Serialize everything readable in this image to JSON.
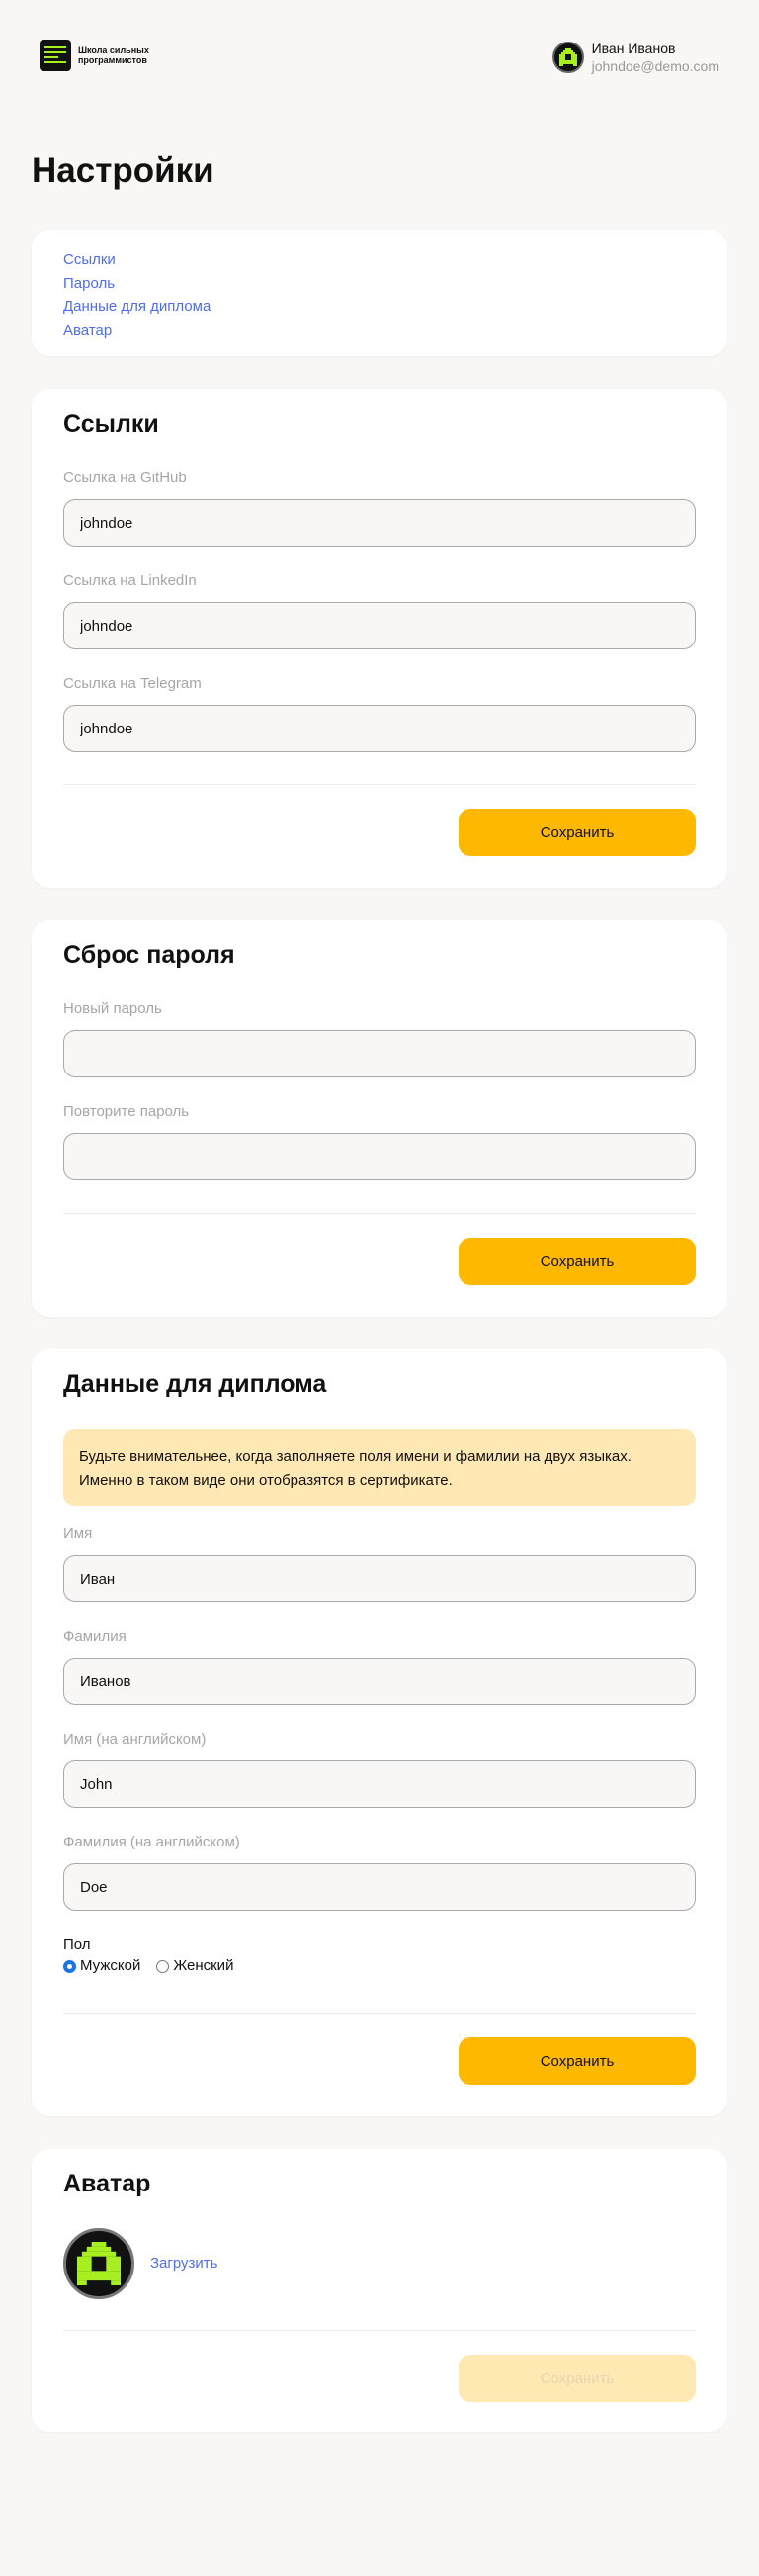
{
  "header": {
    "logo_text": "Школа сильных программистов",
    "user_name": "Иван Иванов",
    "user_email": "johndoe@demo.com"
  },
  "page_title": "Настройки",
  "nav": {
    "items": [
      "Ссылки",
      "Пароль",
      "Данные для диплома",
      "Аватар"
    ]
  },
  "links_section": {
    "title": "Ссылки",
    "github_label": "Ссылка на GitHub",
    "github_value": "johndoe",
    "linkedin_label": "Ссылка на LinkedIn",
    "linkedin_value": "johndoe",
    "telegram_label": "Ссылка на Telegram",
    "telegram_value": "johndoe",
    "save_label": "Сохранить"
  },
  "password_section": {
    "title": "Сброс пароля",
    "new_label": "Новый пароль",
    "new_value": "",
    "repeat_label": "Повторите пароль",
    "repeat_value": "",
    "save_label": "Сохранить"
  },
  "diploma_section": {
    "title": "Данные для диплома",
    "notice": "Будьте внимательнее, когда заполняете поля имени и фамилии на двух языках. Именно в таком виде они отобразятся в сертификате.",
    "first_name_label": "Имя",
    "first_name_value": "Иван",
    "last_name_label": "Фамилия",
    "last_name_value": "Иванов",
    "first_name_en_label": "Имя (на английском)",
    "first_name_en_value": "John",
    "last_name_en_label": "Фамилия (на английском)",
    "last_name_en_value": "Doe",
    "gender_label": "Пол",
    "gender_options": [
      "Мужской",
      "Женский"
    ],
    "gender_selected": "Мужской",
    "save_label": "Сохранить"
  },
  "avatar_section": {
    "title": "Аватар",
    "upload_label": "Загрузить",
    "save_label": "Сохранить",
    "save_disabled": true
  },
  "colors": {
    "accent": "#ffb800",
    "link": "#4f6ee8",
    "avatar_green": "#a8ef22",
    "notice_bg": "#ffe8b3",
    "page_bg": "#f8f7f5"
  },
  "icons": {
    "logo": "terminal-lines-icon",
    "avatar": "space-invader-icon"
  }
}
